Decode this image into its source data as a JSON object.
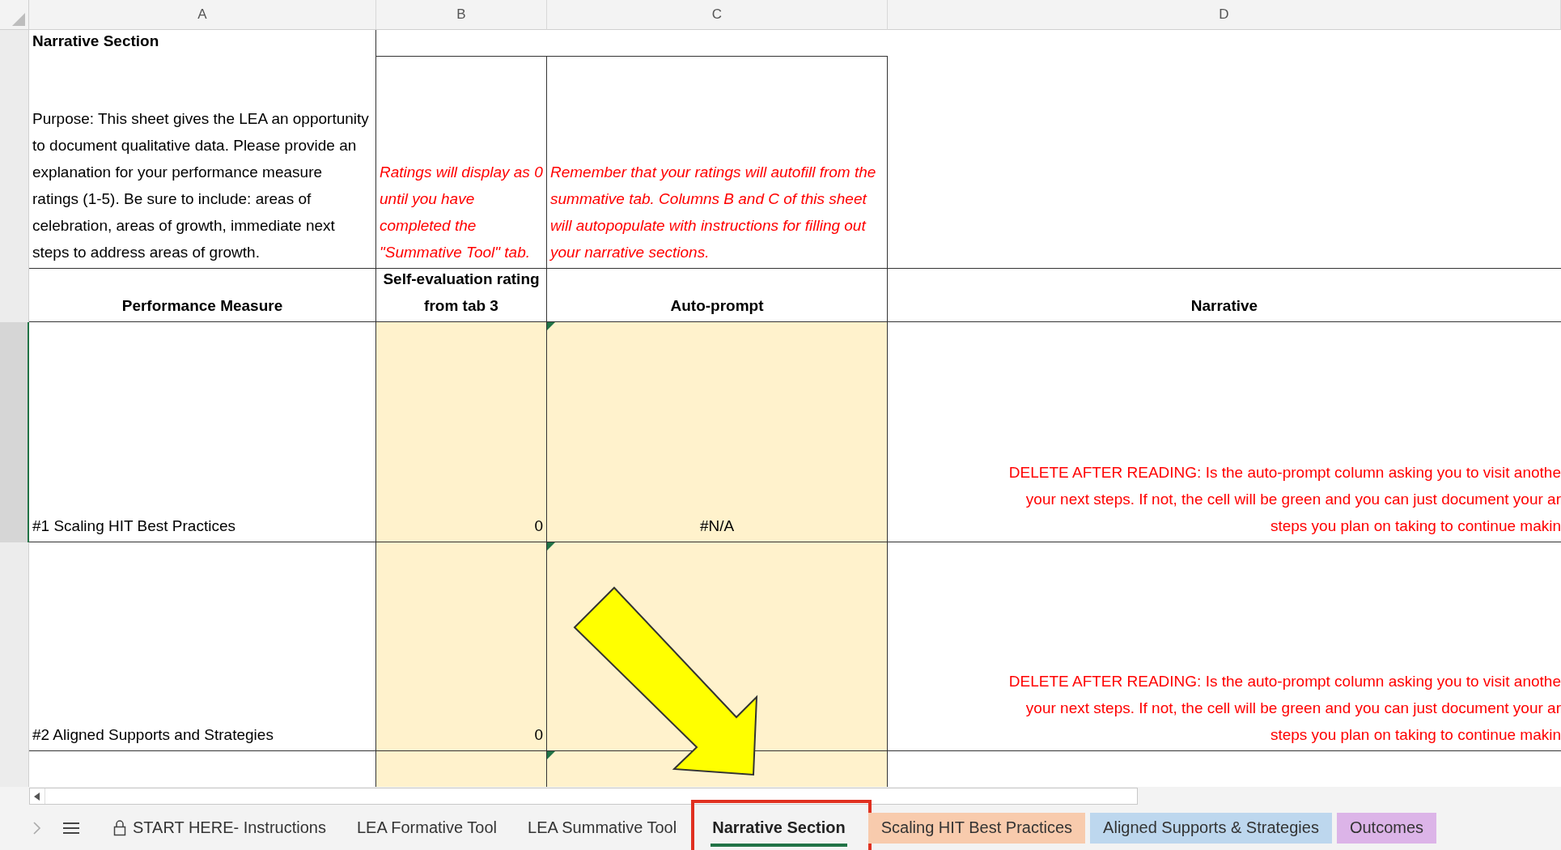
{
  "columns": [
    "A",
    "B",
    "C",
    "D"
  ],
  "title": "Narrative Section",
  "purpose": "Purpose: This sheet gives the LEA an opportunity to document qualitative data. Please provide an explanation for your performance measure ratings (1-5). Be sure to include: areas of celebration, areas of growth, immediate next steps to address areas of growth.",
  "note_b": "Ratings will display as 0 until you have completed the \"Summative Tool\" tab.",
  "note_c": "Remember that your ratings will autofill from the summative tab. Columns B and C of this sheet will autopopulate with instructions for filling out your narrative sections.",
  "headers": [
    "Performance Measure",
    "Self-evaluation rating from tab 3",
    "Auto-prompt",
    "Narrative"
  ],
  "rows": [
    {
      "measure": "#1 Scaling HIT Best Practices",
      "rating": "0",
      "prompt": "#N/A",
      "narrative": [
        "DELETE AFTER READING: Is the auto-prompt column asking you to visit anothe",
        "your next steps. If not, the cell will be green and you can just document your ar",
        "steps you plan on taking to continue makin"
      ]
    },
    {
      "measure": "#2 Aligned Supports and Strategies",
      "rating": "0",
      "narrative": [
        "DELETE AFTER READING: Is the auto-prompt column asking you to visit anothe",
        "your next steps. If not, the cell will be green and you can just document your ar",
        "steps you plan on taking to continue makin"
      ]
    }
  ],
  "tabs": [
    {
      "label": "START HERE- Instructions",
      "locked": true,
      "selected": false
    },
    {
      "label": "LEA Formative Tool",
      "locked": false,
      "selected": false
    },
    {
      "label": "LEA Summative Tool",
      "locked": false,
      "selected": false
    },
    {
      "label": "Narrative Section",
      "locked": false,
      "selected": true
    },
    {
      "label": "Scaling HIT Best Practices",
      "locked": false,
      "selected": false,
      "color": "#f8cbad"
    },
    {
      "label": "Aligned Supports & Strategies",
      "locked": false,
      "selected": false,
      "color": "#bdd7ee"
    },
    {
      "label": "Outcomes",
      "locked": false,
      "selected": false,
      "color": "#dcb4e8"
    }
  ]
}
